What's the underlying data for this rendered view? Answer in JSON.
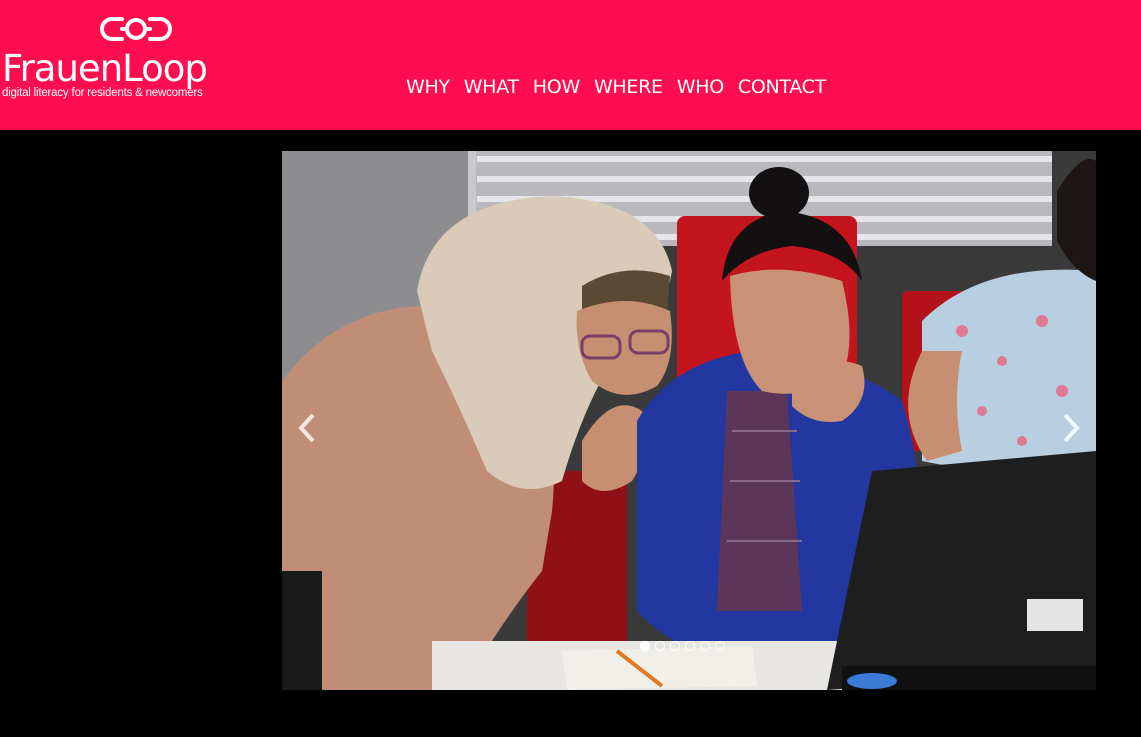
{
  "brand": {
    "name_part1": "Frauen",
    "name_part2": "Loop",
    "tagline": "digital literacy for residents & newcomers",
    "color": "#ff0d4f"
  },
  "nav": {
    "items": [
      {
        "label": "WHY"
      },
      {
        "label": "WHAT"
      },
      {
        "label": "HOW"
      },
      {
        "label": "WHERE"
      },
      {
        "label": "WHO"
      },
      {
        "label": "CONTACT"
      }
    ]
  },
  "carousel": {
    "prev_icon": "chevron-left-icon",
    "next_icon": "chevron-right-icon",
    "slide_count": 6,
    "active_index": 0
  }
}
